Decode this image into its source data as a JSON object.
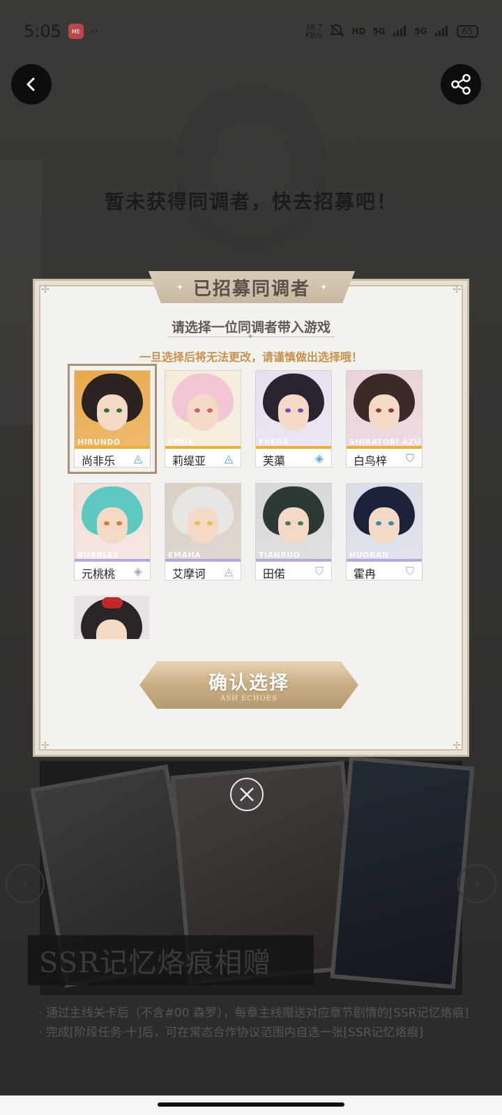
{
  "status_bar": {
    "time": "5:05",
    "app_badge": "ME",
    "dots": "··",
    "net_speed_value": "38.7",
    "net_speed_unit": "KB/s",
    "hd_label": "HD",
    "signal1": "5G",
    "signal2": "5G",
    "battery": "65"
  },
  "background": {
    "empty_message": "暂未获得同调者，快去招募吧！",
    "ssr_banner": "SSR记忆烙痕相赠",
    "notes": [
      "· 通过主线关卡后（不含#00 森罗），每章主线赠送对应章节剧情的[SSR记忆烙痕]",
      "· 完成[阶段任务·十]后，可在常态合作协议范围内自选一张[SSR记忆烙痕]"
    ]
  },
  "modal": {
    "title": "已招募同调者",
    "subtitle": "请选择一位同调者带入游戏",
    "warning": "一旦选择后将无法更改，请谨慎做出选择哦！",
    "confirm_label": "确认选择",
    "confirm_sub": "ASH ECHOES",
    "characters": [
      {
        "romaji": "HIRUNDO",
        "name": "尚非乐",
        "class_icon": "triangle-icon",
        "glyph": "◬",
        "strip": "#e9b13a",
        "hair": "#2b2320",
        "bg": "#e9a94a",
        "eye": "#3a6a3a",
        "selected": true
      },
      {
        "romaji": "LYDIA",
        "name": "莉缇亚",
        "class_icon": "triangle-icon",
        "glyph": "◬",
        "strip": "#e9b13a",
        "hair": "#f2c6d2",
        "bg": "#f5ecd8",
        "eye": "#c85a7a",
        "selected": false
      },
      {
        "romaji": "FREDA",
        "name": "芙蕖",
        "class_icon": "diamond-icon",
        "glyph": "◈",
        "strip": "#e9b13a",
        "hair": "#2a2430",
        "bg": "#e7dff0",
        "eye": "#7a4ab8",
        "selected": false
      },
      {
        "romaji": "SHIRATORI AZUSA",
        "name": "白鸟梓",
        "class_icon": "shield-icon",
        "glyph": "⛉",
        "strip": "#e9b13a",
        "hair": "#3a2a28",
        "bg": "#e9d3d8",
        "eye": "#8a3a3a",
        "selected": false
      },
      {
        "romaji": "BUBBLES",
        "name": "元桃桃",
        "class_icon": "diamond-icon",
        "glyph": "◈",
        "strip": "#b7a6df",
        "hair": "#5cc9c0",
        "bg": "#f2e0da",
        "eye": "#d87a3a",
        "selected": false
      },
      {
        "romaji": "EMAHA",
        "name": "艾摩诃",
        "class_icon": "triangle-icon",
        "glyph": "◬",
        "strip": "#b7a6df",
        "hair": "#e8e6e2",
        "bg": "#d8cfc5",
        "eye": "#e8c048",
        "selected": false
      },
      {
        "romaji": "TIANRUO",
        "name": "田偌",
        "class_icon": "shield-icon",
        "glyph": "⛉",
        "strip": "#b7a6df",
        "hair": "#2d3a34",
        "bg": "#d8d8d8",
        "eye": "#4a7a5a",
        "selected": false
      },
      {
        "romaji": "HUORAN",
        "name": "霍冉",
        "class_icon": "shield-icon",
        "glyph": "⛉",
        "strip": "#b7a6df",
        "hair": "#1e2238",
        "bg": "#d8dde8",
        "eye": "#3a8ab8",
        "selected": false
      }
    ],
    "partial_card": {
      "hair": "#2a2424",
      "bg": "#e6e3e2",
      "bow": "#c0282a"
    }
  },
  "colors": {
    "modal_bg": "#f4f2ee",
    "warning": "#c6924c",
    "confirm_gold": "#c9ad84"
  }
}
